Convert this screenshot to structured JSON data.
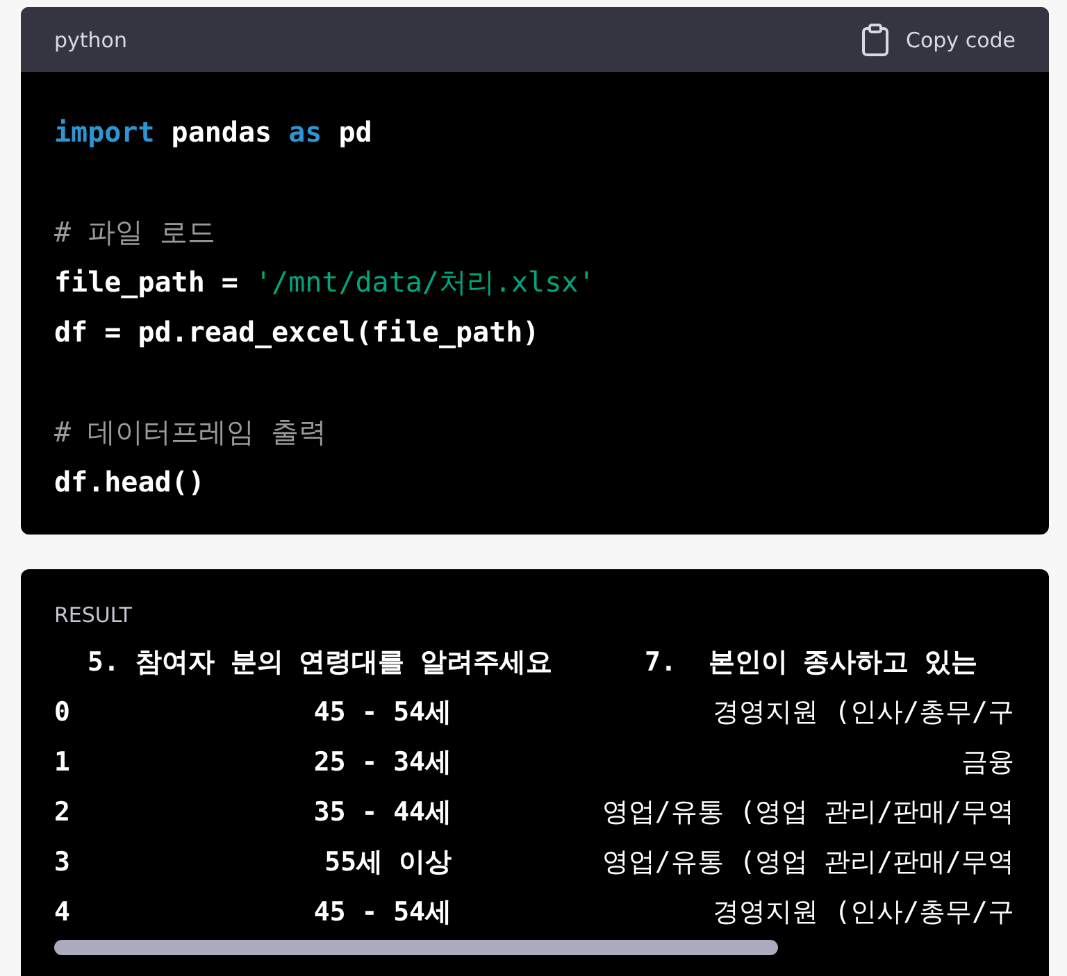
{
  "code_block": {
    "language": "python",
    "copy_button": "Copy code",
    "groups": [
      {
        "lines": [
          [
            {
              "text": "import",
              "kind": "keyword"
            },
            {
              "text": " pandas ",
              "kind": "plain"
            },
            {
              "text": "as",
              "kind": "keyword"
            },
            {
              "text": " pd",
              "kind": "plain"
            }
          ]
        ]
      },
      {
        "lines": [
          [
            {
              "text": "# 파일 로드",
              "kind": "comment"
            }
          ],
          [
            {
              "text": "file_path = ",
              "kind": "plain"
            },
            {
              "text": "'/mnt/data/처리.xlsx'",
              "kind": "string"
            }
          ],
          [
            {
              "text": "df = pd.read_excel(file_path)",
              "kind": "plain"
            }
          ]
        ]
      },
      {
        "lines": [
          [
            {
              "text": "# 데이터프레임 출력",
              "kind": "comment"
            }
          ],
          [
            {
              "text": "df.head()",
              "kind": "plain"
            }
          ]
        ]
      }
    ]
  },
  "result": {
    "label": "RESULT",
    "header": [
      "5. 참여자 분의 연령대를 알려주세요",
      "7.  본인이 종사하고 있는"
    ],
    "rows": [
      {
        "index": "0",
        "column_1": "45 - 54세",
        "column_2": "경영지원 (인사/총무/구"
      },
      {
        "index": "1",
        "column_1": "25 - 34세",
        "column_2": "금융"
      },
      {
        "index": "2",
        "column_1": "35 - 44세",
        "column_2": "영업/유통 (영업 관리/판매/무역"
      },
      {
        "index": "3",
        "column_1": "55세 이상",
        "column_2": "영업/유통 (영업 관리/판매/무역"
      },
      {
        "index": "4",
        "column_1": "45 - 54세",
        "column_2": "경영지원 (인사/총무/구"
      }
    ]
  }
}
